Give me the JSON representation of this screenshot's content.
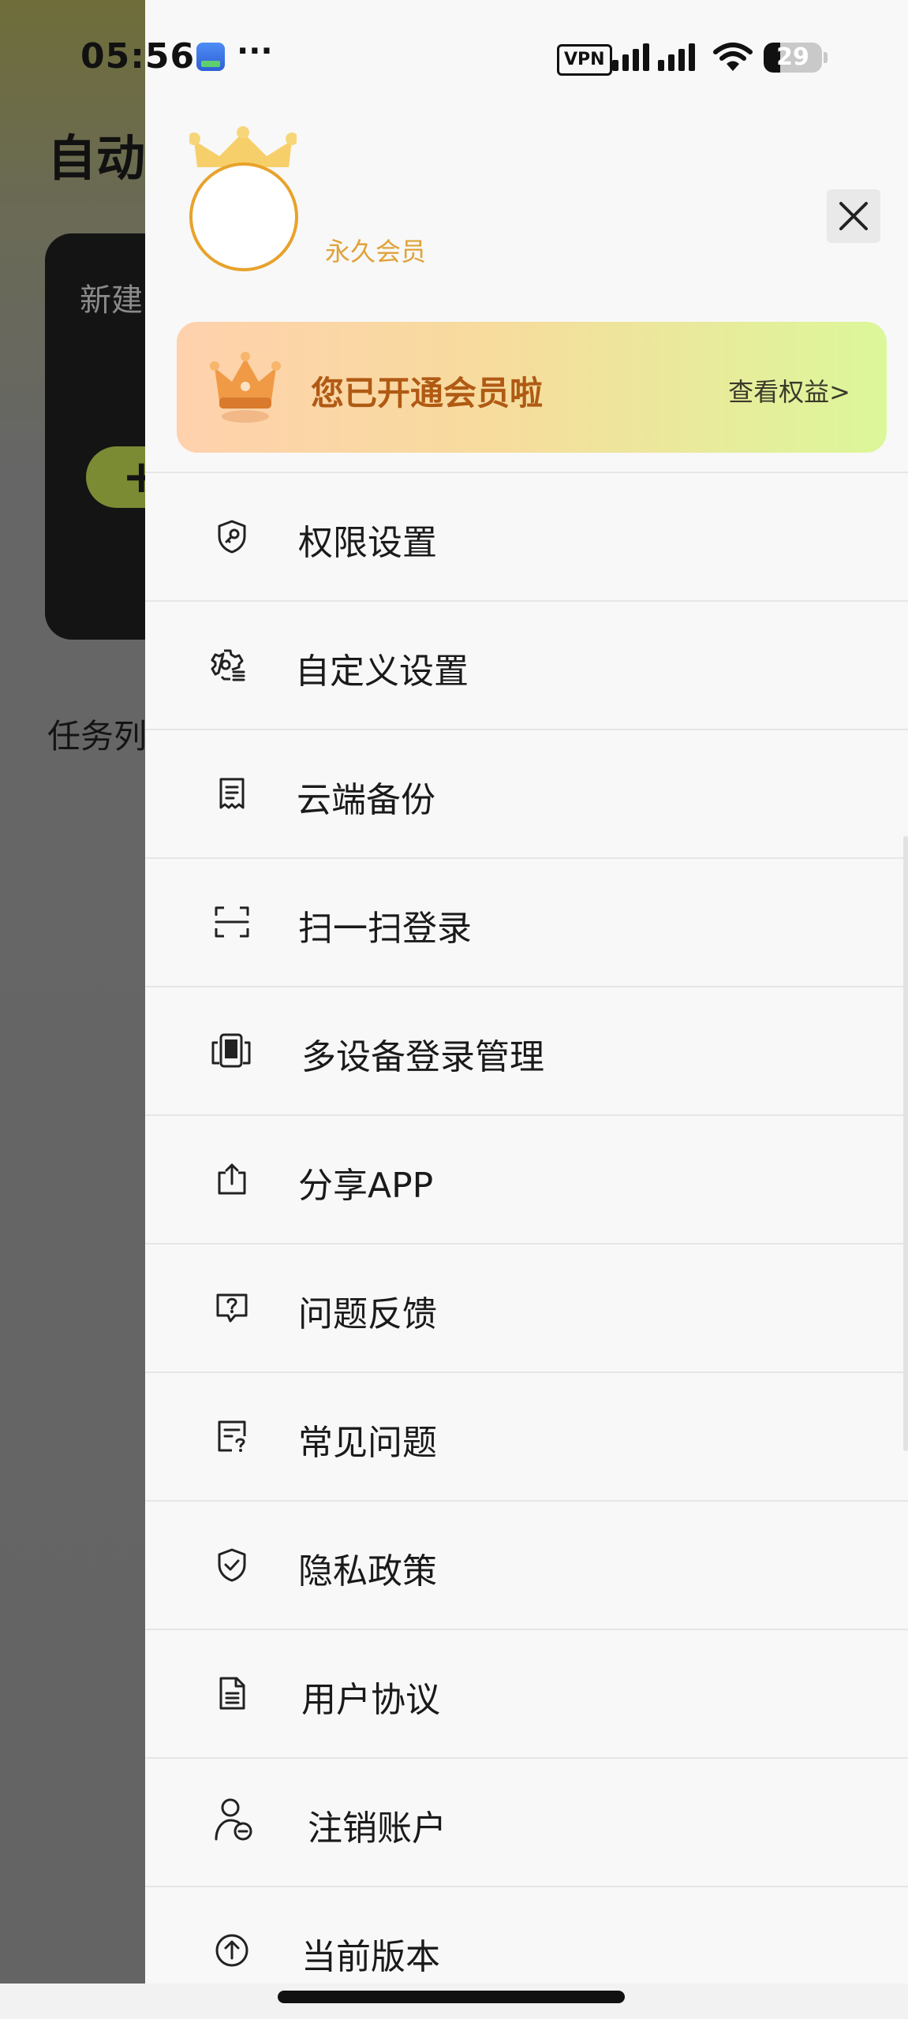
{
  "status_bar": {
    "time": "05:56",
    "more": "···",
    "vpn": "VPN",
    "battery": "29",
    "battery_level": 0.29
  },
  "background_app": {
    "title": "自动",
    "card_label": "新建",
    "card_button_icon": "+",
    "section_title": "任务列"
  },
  "drawer": {
    "member_label": "永久会员",
    "vip_banner": {
      "title": "您已开通会员啦",
      "link": "查看权益>"
    },
    "menu": [
      {
        "label": "权限设置",
        "icon": "shield-key-icon"
      },
      {
        "label": "自定义设置",
        "icon": "gear-list-icon"
      },
      {
        "label": "云端备份",
        "icon": "receipt-icon"
      },
      {
        "label": "扫一扫登录",
        "icon": "scan-icon"
      },
      {
        "label": "多设备登录管理",
        "icon": "devices-icon"
      },
      {
        "label": "分享APP",
        "icon": "share-icon"
      },
      {
        "label": "问题反馈",
        "icon": "feedback-icon"
      },
      {
        "label": "常见问题",
        "icon": "faq-icon"
      },
      {
        "label": "隐私政策",
        "icon": "shield-check-icon"
      },
      {
        "label": "用户协议",
        "icon": "document-icon"
      },
      {
        "label": "注销账户",
        "icon": "user-remove-icon"
      },
      {
        "label": "当前版本",
        "icon": "version-up-icon"
      }
    ]
  },
  "colors": {
    "accent_gold": "#e8a22b",
    "vip_title": "#b05a14"
  }
}
